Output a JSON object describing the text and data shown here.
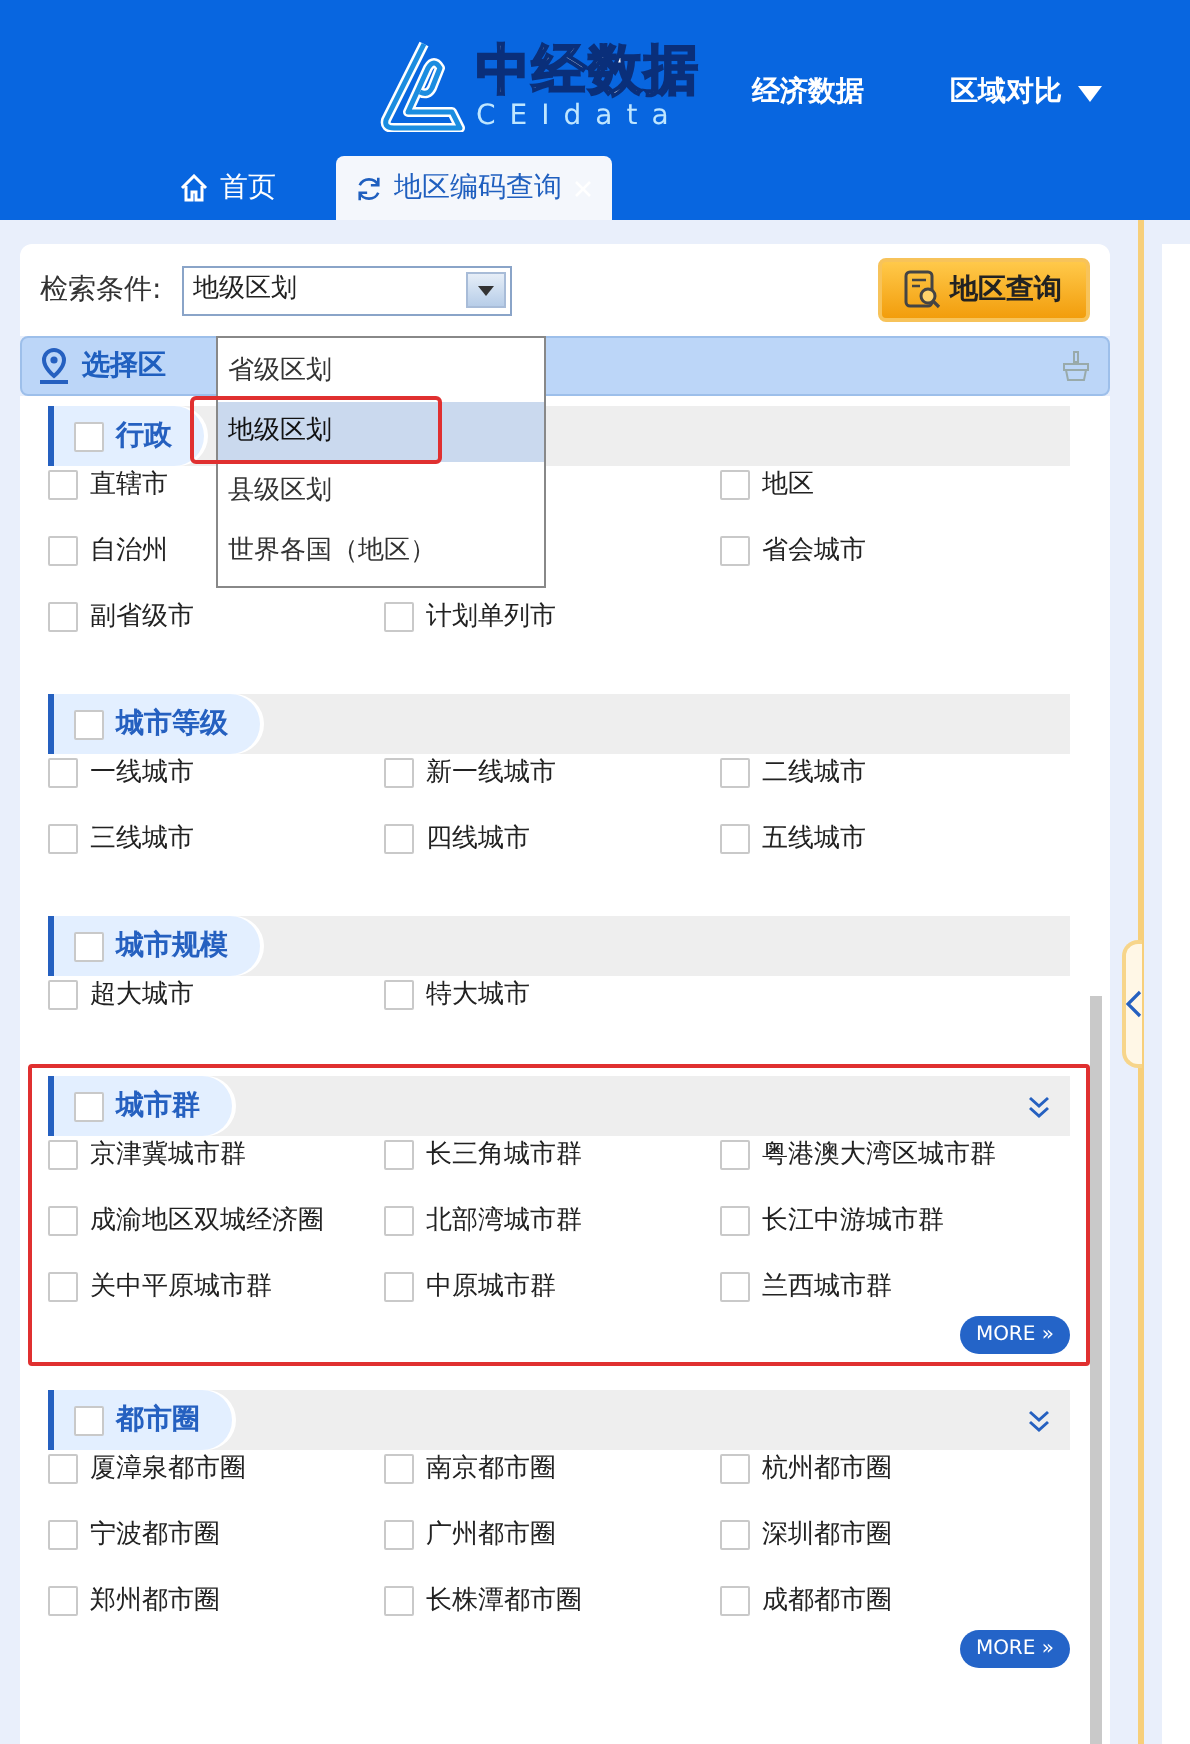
{
  "header": {
    "logo_title": "中经数据",
    "logo_subtitle": "CEIdata",
    "nav": [
      {
        "label": "经济数据",
        "dropdown": false
      },
      {
        "label": "区域对比",
        "dropdown": true
      }
    ]
  },
  "tabs": [
    {
      "label": "首页",
      "selected": false,
      "closable": false
    },
    {
      "label": "地区编码查询",
      "selected": true,
      "closable": true
    }
  ],
  "search": {
    "label": "检索条件:",
    "value": "地级区划",
    "options": [
      {
        "label": "省级区划",
        "selected": false,
        "annotated": false
      },
      {
        "label": "地级区划",
        "selected": true,
        "annotated": true
      },
      {
        "label": "县级区划",
        "selected": false,
        "annotated": false
      },
      {
        "label": "世界各国（地区）",
        "selected": false,
        "annotated": false
      }
    ],
    "button": "地区查询"
  },
  "region_bar": {
    "title": "选择区"
  },
  "sections": [
    {
      "title": "行政",
      "checked": false,
      "expandable": false,
      "annotated": false,
      "rows": [
        [
          {
            "label": "直辖市",
            "checked": false
          },
          null,
          {
            "label": "地区",
            "checked": false
          }
        ],
        [
          {
            "label": "自治州",
            "checked": false
          },
          null,
          {
            "label": "省会城市",
            "checked": false
          }
        ],
        [
          {
            "label": "副省级市",
            "checked": false
          },
          {
            "label": "计划单列市",
            "checked": false
          },
          null
        ]
      ]
    },
    {
      "title": "城市等级",
      "checked": false,
      "expandable": false,
      "annotated": false,
      "rows": [
        [
          {
            "label": "一线城市",
            "checked": false
          },
          {
            "label": "新一线城市",
            "checked": false
          },
          {
            "label": "二线城市",
            "checked": false
          }
        ],
        [
          {
            "label": "三线城市",
            "checked": false
          },
          {
            "label": "四线城市",
            "checked": false
          },
          {
            "label": "五线城市",
            "checked": false
          }
        ]
      ]
    },
    {
      "title": "城市规模",
      "checked": false,
      "expandable": false,
      "annotated": false,
      "rows": [
        [
          {
            "label": "超大城市",
            "checked": false
          },
          {
            "label": "特大城市",
            "checked": false
          },
          null
        ]
      ]
    },
    {
      "title": "城市群",
      "checked": false,
      "expandable": true,
      "annotated": true,
      "more": "MORE »",
      "rows": [
        [
          {
            "label": "京津冀城市群",
            "checked": false
          },
          {
            "label": "长三角城市群",
            "checked": false
          },
          {
            "label": "粤港澳大湾区城市群",
            "checked": false
          }
        ],
        [
          {
            "label": "成渝地区双城经济圈",
            "checked": false
          },
          {
            "label": "北部湾城市群",
            "checked": false
          },
          {
            "label": "长江中游城市群",
            "checked": false
          }
        ],
        [
          {
            "label": "关中平原城市群",
            "checked": false
          },
          {
            "label": "中原城市群",
            "checked": false
          },
          {
            "label": "兰西城市群",
            "checked": false
          }
        ]
      ]
    },
    {
      "title": "都市圈",
      "checked": false,
      "expandable": true,
      "annotated": false,
      "more": "MORE »",
      "rows": [
        [
          {
            "label": "厦漳泉都市圈",
            "checked": false
          },
          {
            "label": "南京都市圈",
            "checked": false
          },
          {
            "label": "杭州都市圈",
            "checked": false
          }
        ],
        [
          {
            "label": "宁波都市圈",
            "checked": false
          },
          {
            "label": "广州都市圈",
            "checked": false
          },
          {
            "label": "深圳都市圈",
            "checked": false
          }
        ],
        [
          {
            "label": "郑州都市圈",
            "checked": false
          },
          {
            "label": "长株潭都市圈",
            "checked": false
          },
          {
            "label": "成都都市圈",
            "checked": false
          }
        ]
      ]
    }
  ]
}
